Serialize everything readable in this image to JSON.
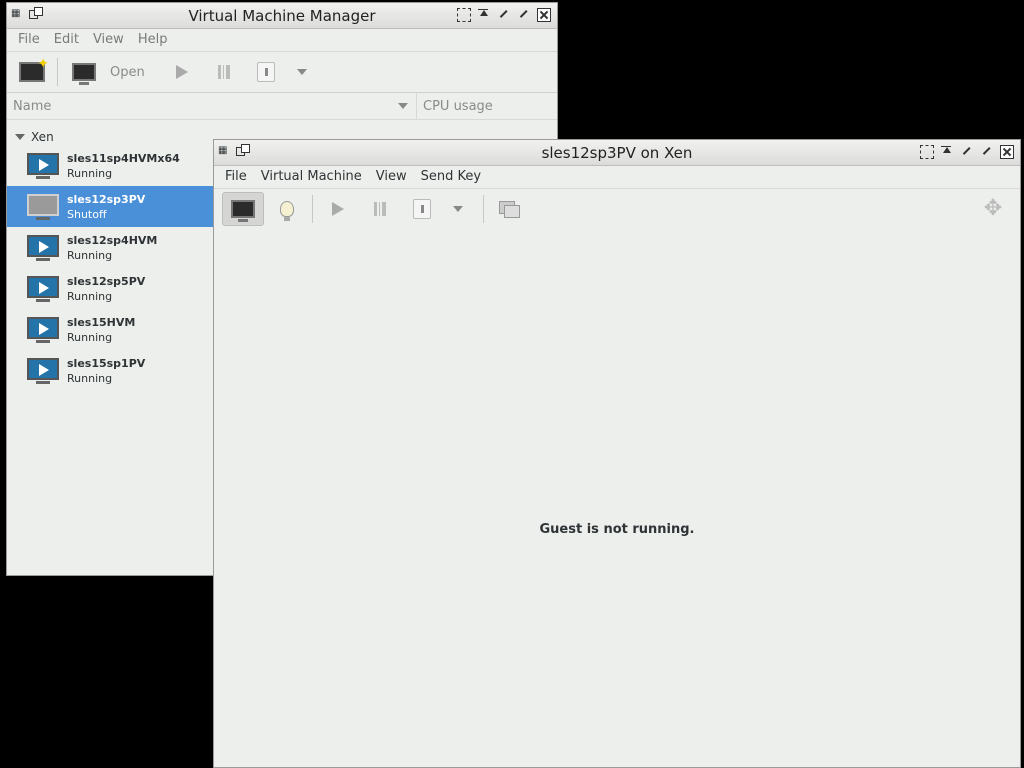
{
  "manager": {
    "title": "Virtual Machine Manager",
    "menu": [
      "File",
      "Edit",
      "View",
      "Help"
    ],
    "toolbar": {
      "open_label": "Open"
    },
    "columns": {
      "name": "Name",
      "cpu": "CPU usage"
    },
    "group": "Xen",
    "vms": [
      {
        "name": "sles11sp4HVMx64",
        "status": "Running",
        "selected": false
      },
      {
        "name": "sles12sp3PV",
        "status": "Shutoff",
        "selected": true
      },
      {
        "name": "sles12sp4HVM",
        "status": "Running",
        "selected": false
      },
      {
        "name": "sles12sp5PV",
        "status": "Running",
        "selected": false
      },
      {
        "name": "sles15HVM",
        "status": "Running",
        "selected": false
      },
      {
        "name": "sles15sp1PV",
        "status": "Running",
        "selected": false
      }
    ]
  },
  "console": {
    "title": "sles12sp3PV on Xen",
    "menu": [
      "File",
      "Virtual Machine",
      "View",
      "Send Key"
    ],
    "message": "Guest is not running."
  },
  "colors": {
    "selection": "#4a90d9",
    "vm_running": "#2574a9"
  }
}
